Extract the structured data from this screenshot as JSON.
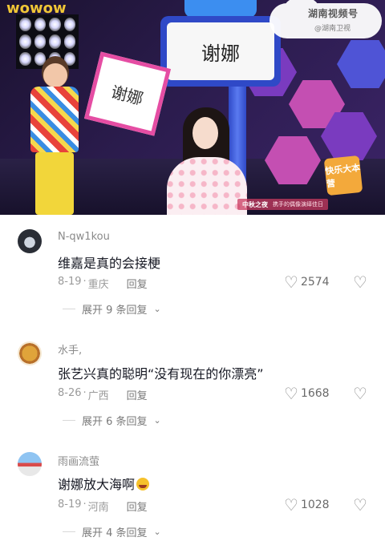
{
  "video": {
    "sign_name": "谢娜",
    "card_text": "谢娜",
    "watermark": "湖南视频号",
    "watermark_sub": "@湖南卫视",
    "corner_text": "wowow",
    "logo_badge": "快乐大本营",
    "bar_title": "中秋之夜",
    "bar_sub": "携手的偶像演绎佳日"
  },
  "comments": [
    {
      "username": "N-qw1kou",
      "text": "维嘉是真的会接梗",
      "date": "8-19",
      "location": "重庆",
      "reply_label": "回复",
      "likes": "2574",
      "expand_label": "展开 9 条回复"
    },
    {
      "username": "水手,",
      "text": "张艺兴真的聪明“没有现在的你漂亮”",
      "date": "8-26",
      "location": "广西",
      "reply_label": "回复",
      "likes": "1668",
      "expand_label": "展开 6 条回复"
    },
    {
      "username": "雨画流萤",
      "text": "谢娜放大海啊",
      "date": "8-19",
      "location": "河南",
      "reply_label": "回复",
      "likes": "1028",
      "expand_label": "展开 4 条回复"
    }
  ],
  "icons": {
    "heart": "heart-outline-icon",
    "dislike": "broken-heart-icon",
    "chevron": "chevron-down-icon",
    "emoji": "crying-laughing-emoji"
  },
  "colors": {
    "text_primary": "#161823",
    "text_secondary": "#8a8a8a",
    "stage_purple": "#7a3bbf",
    "stage_blue": "#2f49c7"
  }
}
